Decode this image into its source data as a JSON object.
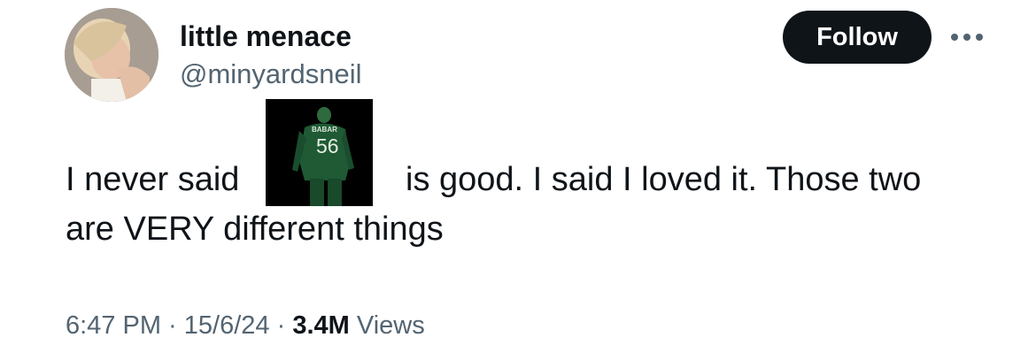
{
  "user": {
    "display_name": "little menace",
    "handle": "@minyardsneil"
  },
  "follow_button_label": "Follow",
  "more_icon": "more-horizontal-icon",
  "tweet": {
    "text_before_image": "I never said",
    "text_after_image": "is good. I said I loved it. Those two",
    "text_line2": "are VERY different things",
    "embedded_image": {
      "jersey_name": "BABAR",
      "jersey_number": "56"
    }
  },
  "meta": {
    "time": "6:47 PM",
    "sep1": " · ",
    "date": "15/6/24",
    "sep2": " · ",
    "views_count": "3.4M",
    "views_label": " Views"
  },
  "colors": {
    "text_primary": "#0f1419",
    "text_secondary": "#536471",
    "button_bg": "#0f1419",
    "jersey_green": "#1f5a35"
  }
}
